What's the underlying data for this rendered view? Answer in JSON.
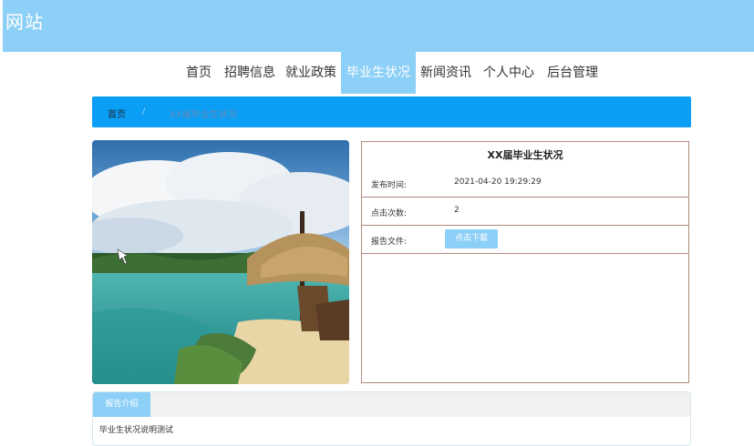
{
  "site": {
    "title": "网站"
  },
  "nav": {
    "items": [
      "首页",
      "招聘信息",
      "就业政策",
      "毕业生状况",
      "新闻资讯",
      "个人中心",
      "后台管理"
    ],
    "active_index": 3
  },
  "breadcrumb": {
    "home": "首页",
    "separator": "/",
    "current": "XX届毕业生状况"
  },
  "detail": {
    "title": "XX届毕业生状况",
    "rows": [
      {
        "label": "发布时间:",
        "value": "2021-04-20 19:29:29"
      },
      {
        "label": "点击次数:",
        "value": "2"
      },
      {
        "label": "报告文件:",
        "button": "点击下载"
      }
    ]
  },
  "panel": {
    "tab": "报告介绍",
    "content": "毕业生状况说明测试"
  },
  "colors": {
    "header": "#8ccff7",
    "breadcrumb": "#0b9ef5",
    "border": "#b08a7e"
  }
}
